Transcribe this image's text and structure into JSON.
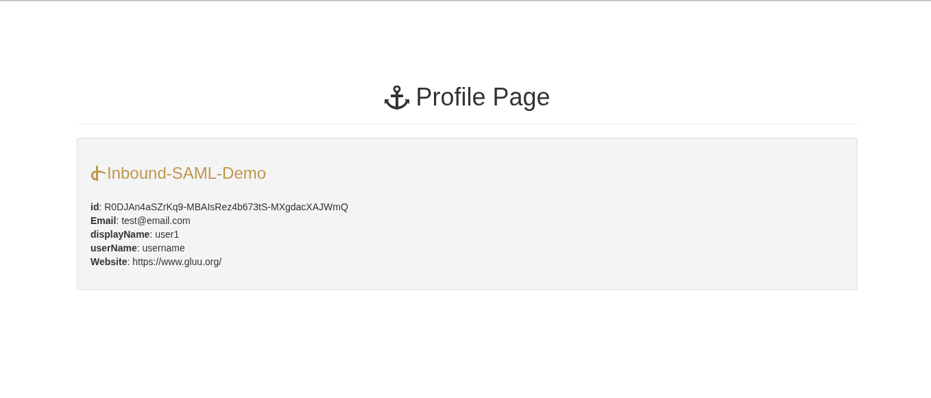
{
  "page_title": "Profile Page",
  "panel": {
    "title": "Inbound-SAML-Demo",
    "fields": [
      "**id**: R0DJAn4aSZrKq9-MBAIsRez4b673tS-MXgdacXAJWmQ",
      "**Email**: test@email.com",
      "**displayName**: user1",
      "**userName**: username",
      "**Website**: https://www.gluu.org/"
    ]
  }
}
